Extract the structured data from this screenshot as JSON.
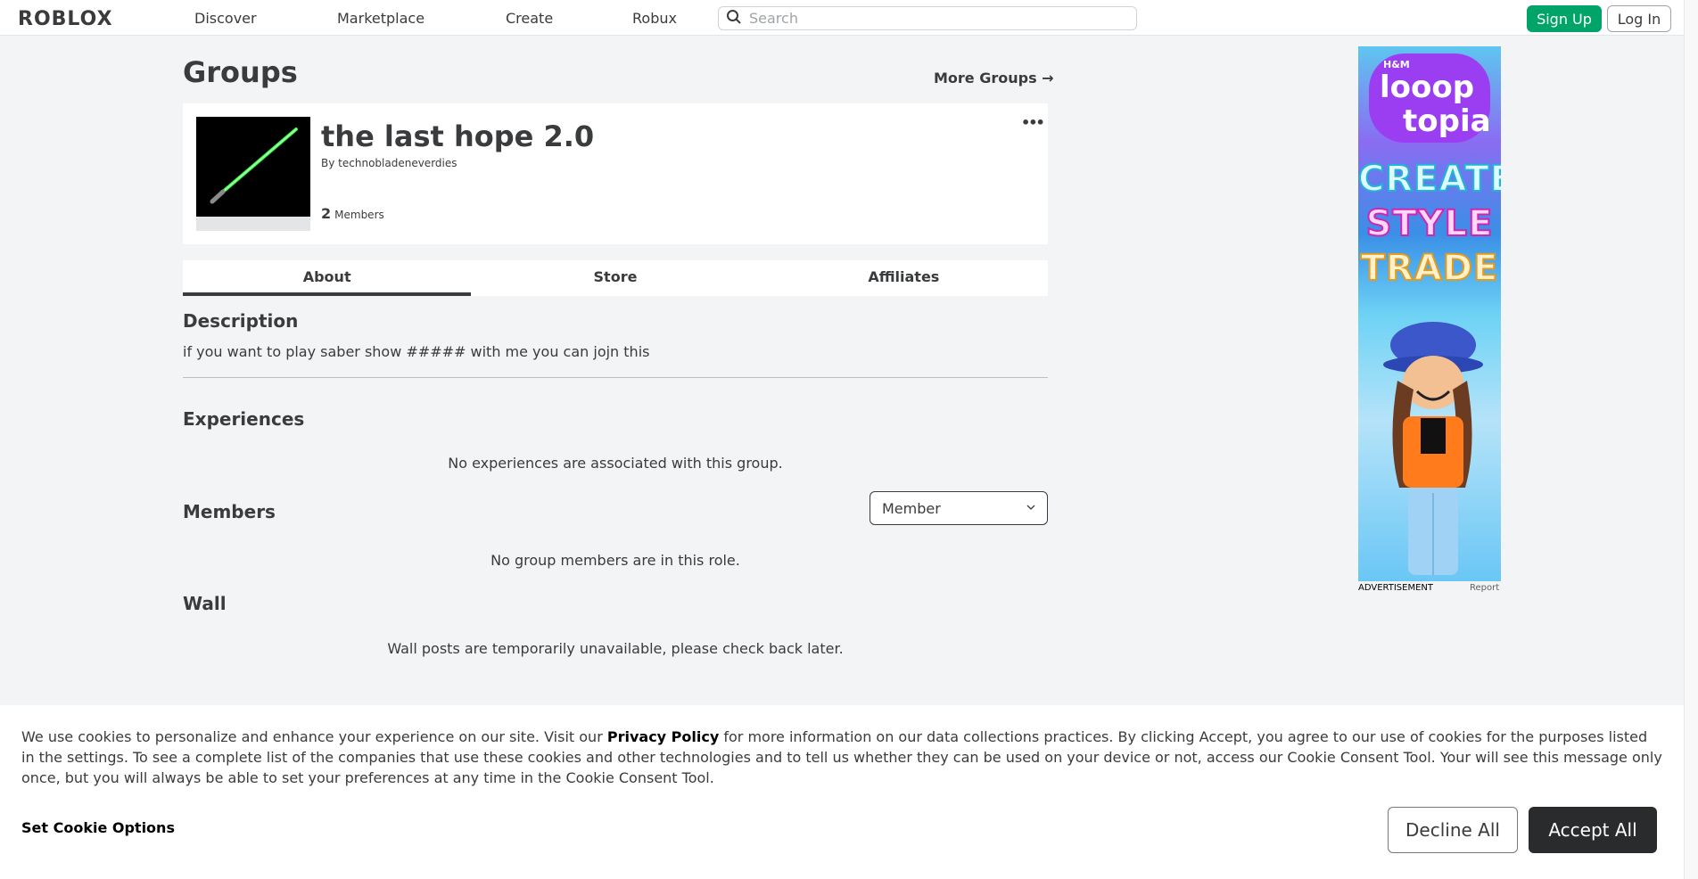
{
  "nav": {
    "logo": "ROBLOX",
    "links": [
      "Discover",
      "Marketplace",
      "Create",
      "Robux"
    ],
    "search_placeholder": "Search",
    "signup": "Sign Up",
    "login": "Log In"
  },
  "header": {
    "title": "Groups",
    "more_groups": "More Groups →"
  },
  "group": {
    "name": "the last hope 2.0",
    "by_prefix": "By",
    "owner": "technobladeneverdies",
    "member_count": "2",
    "members_label": "Members",
    "more_options": "•••"
  },
  "tabs": [
    "About",
    "Store",
    "Affiliates"
  ],
  "about": {
    "description_title": "Description",
    "description_text": "if you want to play saber show ##### with me you can jojn this",
    "experiences_title": "Experiences",
    "experiences_empty": "No experiences are associated with this group.",
    "members_title": "Members",
    "role_selected": "Member",
    "members_empty": "No group members are in this role.",
    "wall_title": "Wall",
    "wall_empty": "Wall posts are temporarily unavailable, please check back later."
  },
  "ad": {
    "brand_small": "H&M",
    "brand_line1": "looop",
    "brand_line2": "topia",
    "words": [
      "CREATE",
      "STYLE",
      "TRADE"
    ],
    "label": "ADVERTISEMENT",
    "report": "Report"
  },
  "cookie": {
    "text_part1": "We use cookies to personalize and enhance your experience on our site. Visit our ",
    "privacy_link": "Privacy Policy",
    "text_part2": " for more information on our data collections practices. By clicking Accept, you agree to our use of cookies for the purposes listed in the settings. To see a complete list of the companies that use these cookies and other technologies and to tell us whether they can be used on your device or not, access our Cookie Consent Tool. Your will see this message only once, but you will always be able to set your preferences at any time in the Cookie Consent Tool.",
    "set_options": "Set Cookie Options",
    "decline": "Decline All",
    "accept": "Accept All"
  },
  "colors": {
    "signup_green": "#00a468",
    "accept_dark": "#2a2b2d",
    "page_bg": "#f2f4f5",
    "text": "#393b3d"
  }
}
